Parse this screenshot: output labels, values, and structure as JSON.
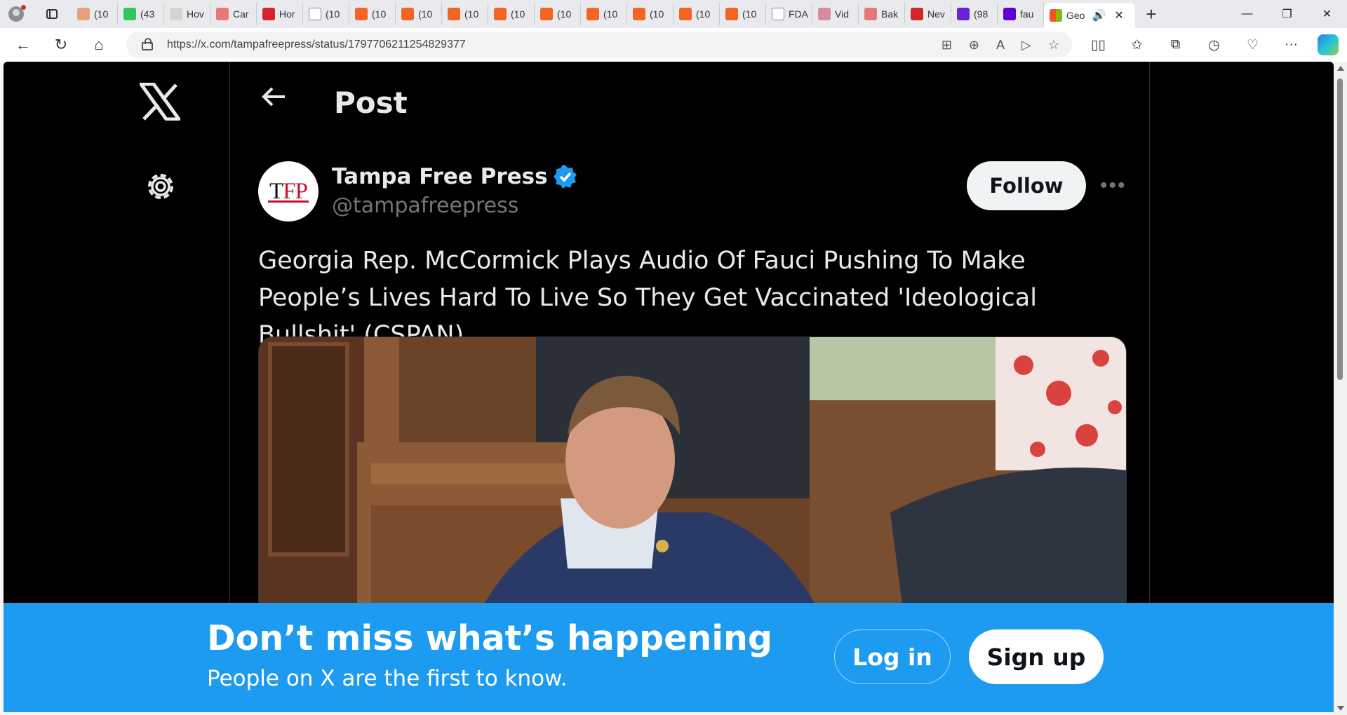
{
  "browser": {
    "tabs": [
      {
        "label": "(10",
        "fav_color": "#e8a07a"
      },
      {
        "label": "(43",
        "fav_color": "#33c65b"
      },
      {
        "label": "Hov",
        "fav_color": "#d9d3cf"
      },
      {
        "label": "Car",
        "fav_color": "#e87878"
      },
      {
        "label": "Hor",
        "fav_color": "#d5232a"
      },
      {
        "label": "(10",
        "fav_color": "#ffffff"
      },
      {
        "label": "(10",
        "fav_color": "#f26522"
      },
      {
        "label": "(10",
        "fav_color": "#f26522"
      },
      {
        "label": "(10",
        "fav_color": "#f26522"
      },
      {
        "label": "(10",
        "fav_color": "#f26522"
      },
      {
        "label": "(10",
        "fav_color": "#f26522"
      },
      {
        "label": "(10",
        "fav_color": "#f26522"
      },
      {
        "label": "(10",
        "fav_color": "#f26522"
      },
      {
        "label": "(10",
        "fav_color": "#f26522"
      },
      {
        "label": "(10",
        "fav_color": "#f26522"
      },
      {
        "label": "FDA",
        "fav_color": "#ffffff"
      },
      {
        "label": "Vid",
        "fav_color": "#d98aa0"
      },
      {
        "label": "Bak",
        "fav_color": "#e87878"
      },
      {
        "label": "Nev",
        "fav_color": "#d5232a"
      },
      {
        "label": "(98",
        "fav_color": "#6b21d9"
      },
      {
        "label": "fau",
        "fav_color": "#6001d2"
      }
    ],
    "active_tab": {
      "label": "Geo"
    },
    "url": "https://x.com/tampafreepress/status/1797706211254829377",
    "window_buttons": {
      "minimize": "—",
      "restore": "❐",
      "close": "✕"
    }
  },
  "page": {
    "header_title": "Post",
    "author": {
      "display_name": "Tampa Free Press",
      "handle": "@tampafreepress",
      "avatar_text_t": "T",
      "avatar_text_fp": "FP",
      "verified": true
    },
    "follow_label": "Follow",
    "more_label": "•••",
    "tweet_text": "Georgia Rep. McCormick Plays Audio Of Fauci Pushing To Make People’s Lives Hard To Live So They Get Vaccinated 'Ideological Bullshit' (CSPAN)"
  },
  "banner": {
    "headline": "Don’t miss what’s happening",
    "subtext": "People on X are the first to know.",
    "login_label": "Log in",
    "signup_label": "Sign up"
  },
  "colors": {
    "accent": "#1d9bf0",
    "background": "#000000",
    "verified": "#1d9bf0"
  }
}
